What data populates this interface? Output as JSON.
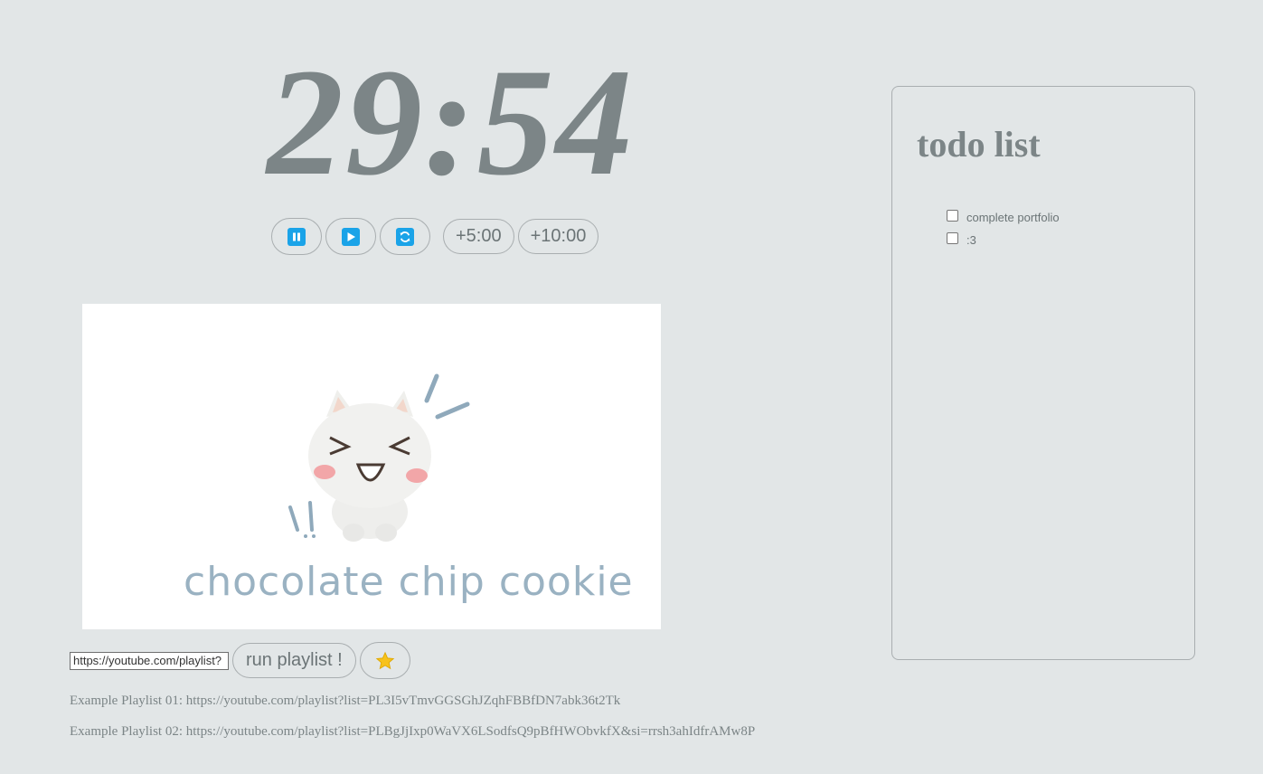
{
  "timer": {
    "display": "29:54"
  },
  "controls": {
    "add5_label": "+5:00",
    "add10_label": "+10:00"
  },
  "video": {
    "caption": "chocolate chip cookie"
  },
  "playlist": {
    "input_value": "https://youtube.com/playlist?",
    "run_label": "run playlist !",
    "examples": [
      "Example Playlist 01: https://youtube.com/playlist?list=PL3I5vTmvGGSGhJZqhFBBfDN7abk36t2Tk",
      "Example Playlist 02: https://youtube.com/playlist?list=PLBgJjIxp0WaVX6LSodfsQ9pBfHWObvkfX&si=rrsh3ahIdfrAMw8P"
    ]
  },
  "todo": {
    "title": "todo list",
    "items": [
      {
        "label": "complete portfolio",
        "checked": false
      },
      {
        "label": ":3",
        "checked": false
      }
    ]
  },
  "colors": {
    "background": "#e2e6e7",
    "text_muted": "#7c8587",
    "accent_icon": "#1aa3e8",
    "star": "#f7c21b"
  },
  "icons": [
    "pause-icon",
    "play-icon",
    "reset-icon",
    "star-icon"
  ]
}
